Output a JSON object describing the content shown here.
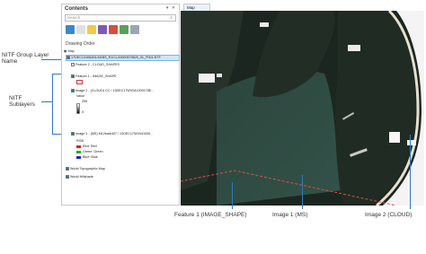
{
  "annotations": {
    "nitf_group": "NITF Group Layer Name",
    "nitf_sublayers": "NITF Sublayers",
    "feature1": "Feature 1 (IMAGE_SHAPE)",
    "image1": "Image 1 (MS)",
    "image2": "Image 2 (CLOUD)"
  },
  "contents": {
    "title": "Contents",
    "controls": "▾ ✕",
    "search_placeholder": "Search",
    "drawing_order": "Drawing Order",
    "rows": [
      {
        "id": "map",
        "label": "Map"
      },
      {
        "id": "group",
        "label": "17DEC13165404-M1BS_R1C1-00000579825_01_P001.NTF"
      },
      {
        "id": "feat2",
        "label": "Feature 2 - CLOUD_SHAPES"
      },
      {
        "id": "feat1",
        "label": "Feature 1 - IMAGE_SHAPE"
      },
      {
        "id": "img2",
        "label": "Image 2 - (CLOUD) CC / 13DEC17WV041000178E..."
      },
      {
        "id": "value",
        "label": "Value"
      },
      {
        "id": "v255",
        "label": "255"
      },
      {
        "id": "v0",
        "label": "0"
      },
      {
        "id": "img1",
        "label": "Image 1 - (MS) M12bale407 / 13DEC17WV041000..."
      },
      {
        "id": "rgb",
        "label": "RGB"
      },
      {
        "id": "red",
        "label": "Red:   Red"
      },
      {
        "id": "green",
        "label": "Green: Green"
      },
      {
        "id": "blue",
        "label": "Blue:  Blue"
      },
      {
        "id": "topo",
        "label": "World Topographic Map"
      },
      {
        "id": "hill",
        "label": "World Hillshade"
      }
    ]
  },
  "map_tab": "Map",
  "colors": {
    "accent": "#2f7ac0",
    "selection": "#cde6f7",
    "water": "#2f4a42",
    "land": "#1c2620",
    "beach": "#e7e0cf"
  }
}
